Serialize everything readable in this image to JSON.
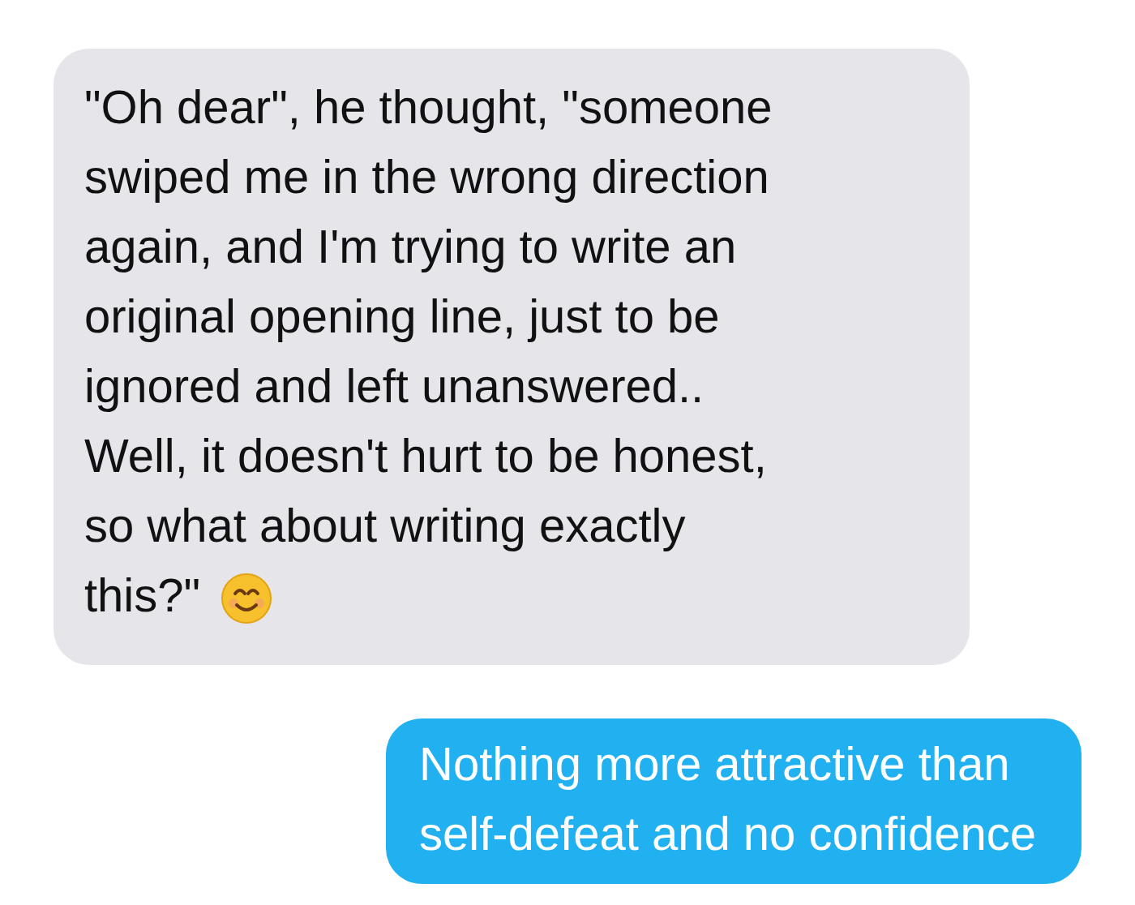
{
  "messages": [
    {
      "kind": "incoming",
      "text": "\"Oh dear\", he thought, \"someone\nswiped me in the wrong direction\nagain, and I'm trying to write an\noriginal opening line, just to be\nignored and left unanswered..\nWell, it doesn't hurt to be honest,\nso what about writing exactly",
      "last_line": "this?\"",
      "emoji": true
    },
    {
      "kind": "outgoing",
      "text": "Nothing more attractive than\nself-defeat and no confidence",
      "emoji": false
    }
  ]
}
